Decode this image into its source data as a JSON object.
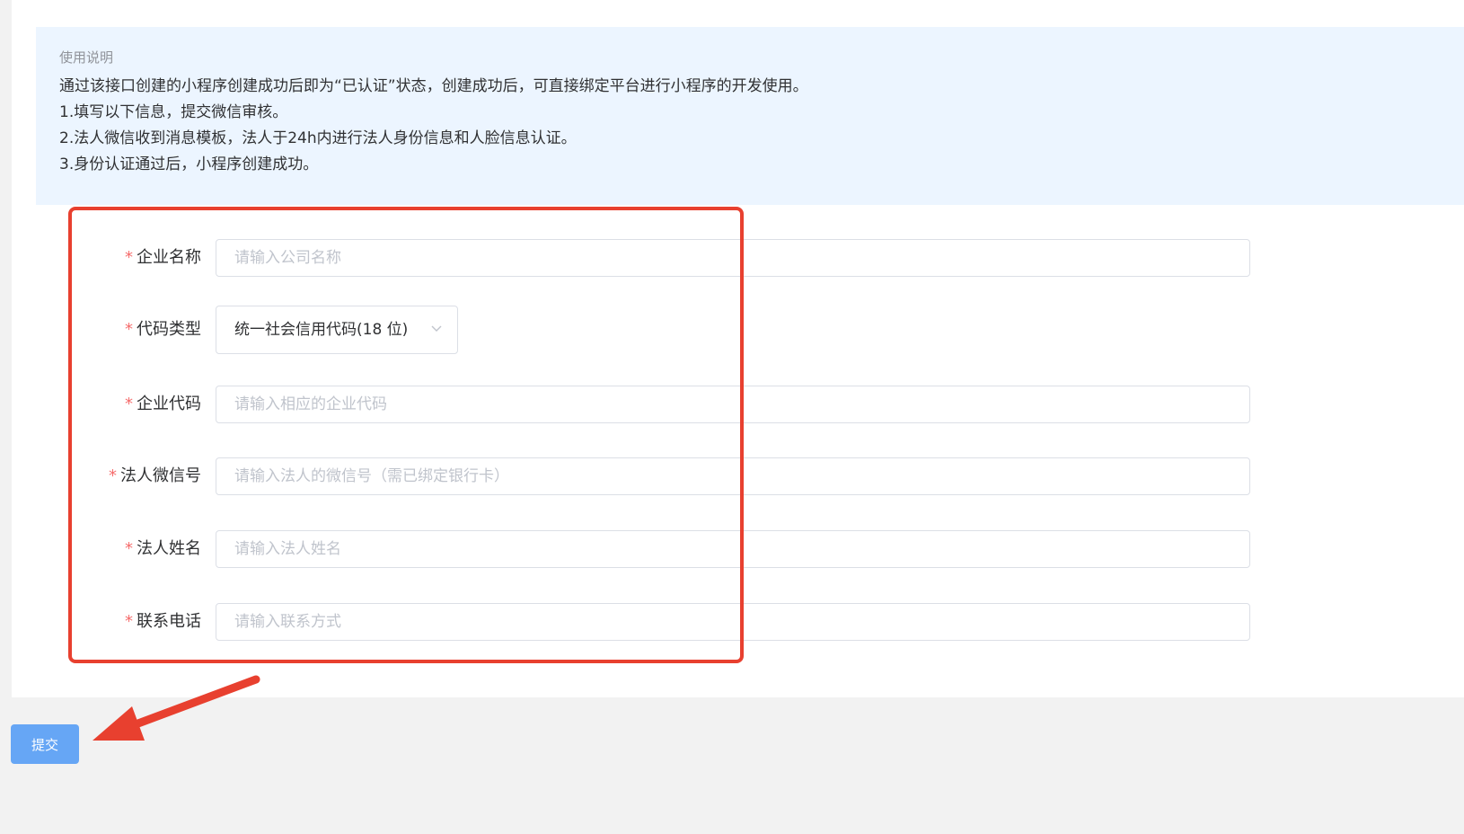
{
  "notice": {
    "title": "使用说明",
    "lines": [
      "通过该接口创建的小程序创建成功后即为“已认证”状态，创建成功后，可直接绑定平台进行小程序的开发使用。",
      "1.填写以下信息，提交微信审核。",
      "2.法人微信收到消息模板，法人于24h内进行法人身份信息和人脸信息认证。",
      "3.身份认证通过后，小程序创建成功。"
    ]
  },
  "form": {
    "required_mark": "*",
    "company_name": {
      "label": "企业名称",
      "value": "",
      "placeholder": "请输入公司名称"
    },
    "code_type": {
      "label": "代码类型",
      "selected": "统一社会信用代码(18 位)"
    },
    "company_code": {
      "label": "企业代码",
      "value": "",
      "placeholder": "请输入相应的企业代码"
    },
    "legal_wechat": {
      "label": "法人微信号",
      "value": "",
      "placeholder": "请输入法人的微信号（需已绑定银行卡）"
    },
    "legal_name": {
      "label": "法人姓名",
      "value": "",
      "placeholder": "请输入法人姓名"
    },
    "contact_phone": {
      "label": "联系电话",
      "value": "",
      "placeholder": "请输入联系方式"
    }
  },
  "actions": {
    "submit_label": "提交"
  },
  "colors": {
    "primary_button": "#66a6f5",
    "notice_background": "#ecf5ff",
    "required_mark": "#f56c6c",
    "annotation": "#e8402f"
  },
  "icons": {
    "select_arrow": "chevron-down-icon",
    "annotation_arrow": "arrow-icon"
  }
}
